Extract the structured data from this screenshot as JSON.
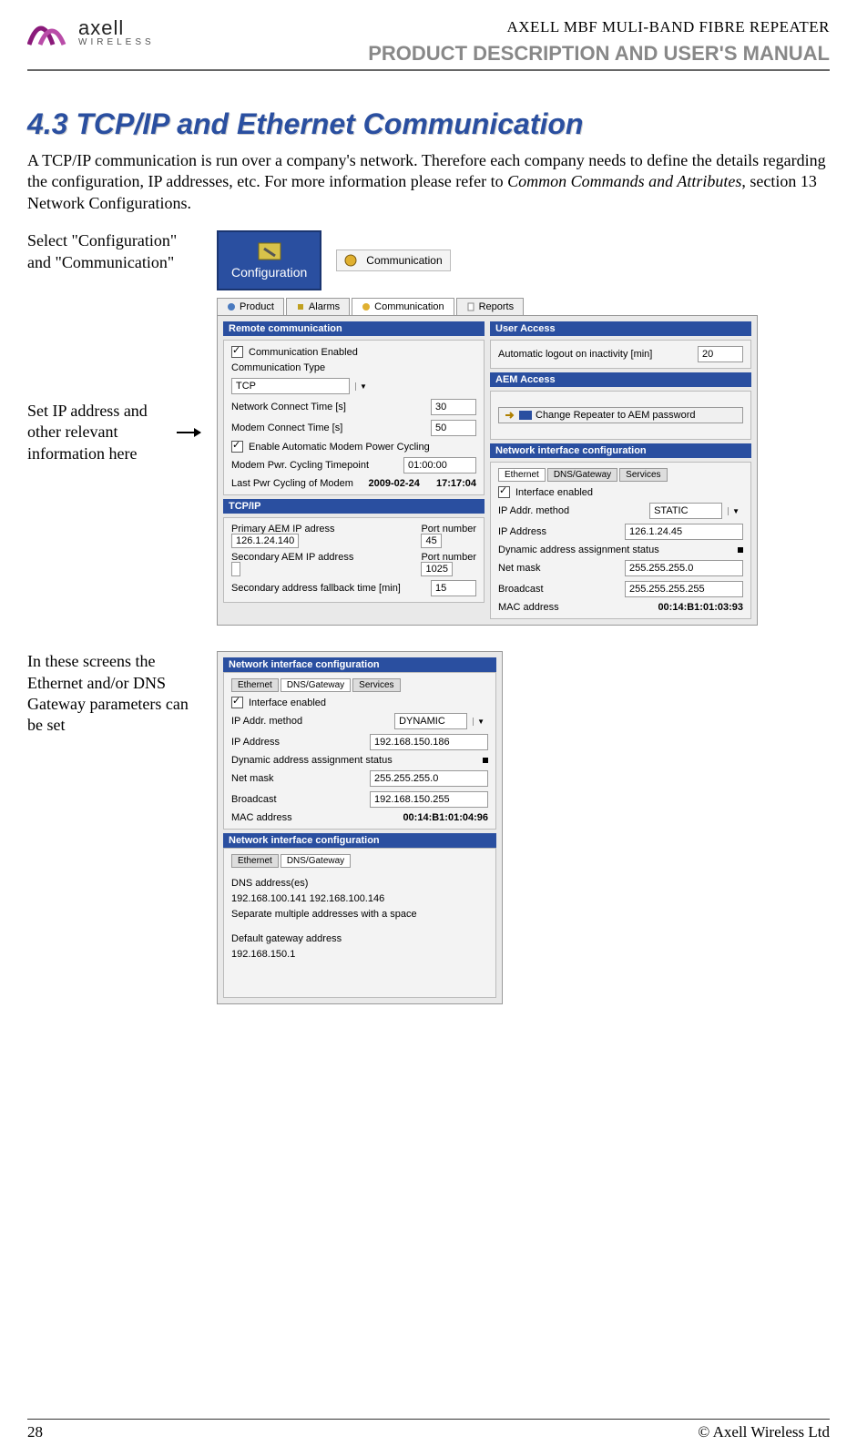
{
  "header": {
    "logo_main": "axell",
    "logo_sub": "WIRELESS",
    "top_right": "AXELL MBF MULI-BAND FIBRE REPEATER",
    "sub_right": "PRODUCT DESCRIPTION AND USER'S MANUAL"
  },
  "section_title": "4.3  TCP/IP and Ethernet Communication",
  "intro_para_1": "A TCP/IP communication is run over a company's network. Therefore each company needs to define the details regarding the configuration, IP addresses, etc. For more information please refer to ",
  "intro_para_ital": "Common Commands and Attributes",
  "intro_para_2": ", section 13 Network Configurations.",
  "left_notes": {
    "note1": "Select \"Configuration\" and \"Communication\"",
    "note2": "Set IP address and other relevant information here",
    "note3": "In these screens the Ethernet and/or DNS Gateway parameters can be set"
  },
  "toolbar": {
    "config_btn": "Configuration",
    "comm_btn": "Communication"
  },
  "tabs": {
    "product": "Product",
    "alarms": "Alarms",
    "communication": "Communication",
    "reports": "Reports"
  },
  "remote_comm": {
    "title": "Remote communication",
    "chk_comm_enabled": "Communication Enabled",
    "lbl_comm_type": "Communication Type",
    "val_comm_type": "TCP",
    "lbl_net_connect": "Network Connect Time [s]",
    "val_net_connect": "30",
    "lbl_modem_connect": "Modem Connect Time [s]",
    "val_modem_connect": "50",
    "chk_auto_cycle": "Enable Automatic Modem Power Cycling",
    "lbl_cycle_time": "Modem Pwr. Cycling Timepoint",
    "val_cycle_time": "01:00:00",
    "lbl_last_cycle": "Last Pwr Cycling of Modem",
    "val_last_cycle_date": "2009-02-24",
    "val_last_cycle_time": "17:17:04"
  },
  "tcpip": {
    "title": "TCP/IP",
    "lbl_primary": "Primary AEM IP adress",
    "val_primary": "126.1.24.140",
    "lbl_port1": "Port number",
    "val_port1": "45",
    "lbl_secondary": "Secondary AEM IP address",
    "val_secondary": "",
    "lbl_port2": "Port number",
    "val_port2": "1025",
    "lbl_fallback": "Secondary address fallback time [min]",
    "val_fallback": "15"
  },
  "user_access": {
    "title": "User Access",
    "lbl_logout": "Automatic logout on inactivity [min]",
    "val_logout": "20"
  },
  "aem_access": {
    "title": "AEM Access",
    "btn_change": "Change Repeater to AEM password"
  },
  "netif1": {
    "title": "Network interface configuration",
    "tab_eth": "Ethernet",
    "tab_dns": "DNS/Gateway",
    "tab_srv": "Services",
    "chk_ifenabled": "Interface enabled",
    "lbl_method": "IP Addr. method",
    "val_method": "STATIC",
    "lbl_ip": "IP Address",
    "val_ip": "126.1.24.45",
    "lbl_dyn": "Dynamic address assignment status",
    "lbl_mask": "Net mask",
    "val_mask": "255.255.255.0",
    "lbl_bcast": "Broadcast",
    "val_bcast": "255.255.255.255",
    "lbl_mac": "MAC address",
    "val_mac": "00:14:B1:01:03:93"
  },
  "netif2": {
    "title": "Network interface configuration",
    "tab_eth": "Ethernet",
    "tab_dns": "DNS/Gateway",
    "tab_srv": "Services",
    "chk_ifenabled": "Interface enabled",
    "lbl_method": "IP Addr. method",
    "val_method": "DYNAMIC",
    "lbl_ip": "IP Address",
    "val_ip": "192.168.150.186",
    "lbl_dyn": "Dynamic address assignment status",
    "lbl_mask": "Net mask",
    "val_mask": "255.255.255.0",
    "lbl_bcast": "Broadcast",
    "val_bcast": "192.168.150.255",
    "lbl_mac": "MAC address",
    "val_mac": "00:14:B1:01:04:96"
  },
  "netif3": {
    "title": "Network interface configuration",
    "tab_eth": "Ethernet",
    "tab_dns": "DNS/Gateway",
    "lbl_dns": "DNS address(es)",
    "val_dns": "192.168.100.141 192.168.100.146",
    "lbl_sep": "Separate multiple addresses with a space",
    "lbl_gw": "Default gateway address",
    "val_gw": "192.168.150.1"
  },
  "footer": {
    "page": "28",
    "copyright": "© Axell Wireless Ltd"
  }
}
